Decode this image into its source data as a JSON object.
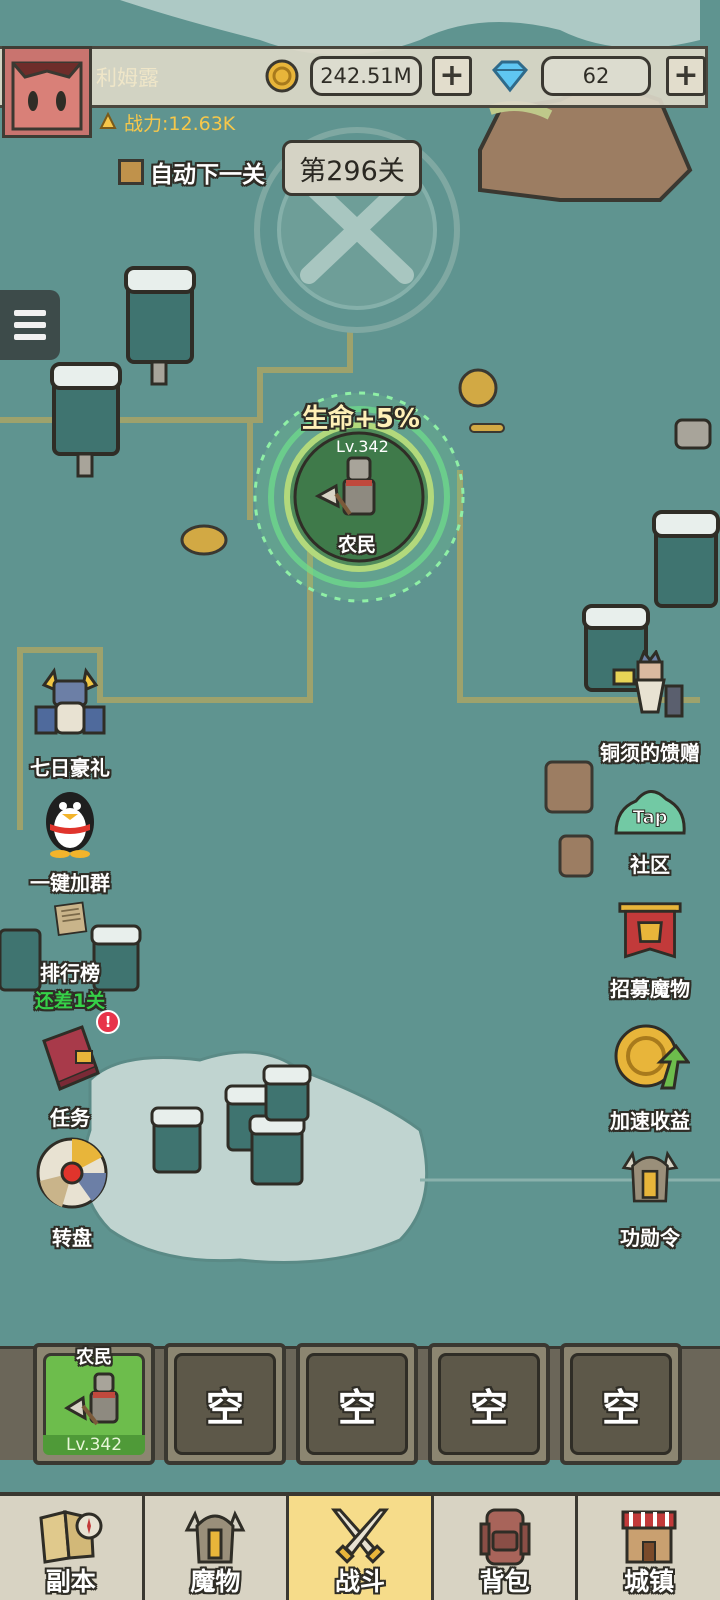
{
  "player": {
    "name": "利姆露",
    "gold": "242.51M",
    "gems": "62",
    "power": "战力:12.63K"
  },
  "stage": {
    "auto_next_label": "自动下一关",
    "level_label": "第296关"
  },
  "hero_marker": {
    "bonus": "生命+5%",
    "level": "Lv.342",
    "name": "农民"
  },
  "left_buttons": [
    {
      "label": "七日豪礼",
      "icon": "viking-gift-icon"
    },
    {
      "label": "一键加群",
      "icon": "penguin-icon"
    },
    {
      "label": "排行榜",
      "sub": "还差1关",
      "icon": "scroll-icon"
    },
    {
      "label": "任务",
      "icon": "book-icon",
      "badge": "!"
    },
    {
      "label": "转盘",
      "icon": "wheel-icon"
    }
  ],
  "right_buttons": [
    {
      "label": "铜须的馈赠",
      "icon": "dwarf-icon"
    },
    {
      "label": "社区",
      "icon": "tap-slime-icon",
      "icon_text": "Tap"
    },
    {
      "label": "招募魔物",
      "icon": "banner-icon"
    },
    {
      "label": "加速收益",
      "icon": "coin-arrow-icon"
    },
    {
      "label": "功勋令",
      "icon": "helmet-icon"
    }
  ],
  "party": {
    "hero": {
      "name": "农民",
      "level": "Lv.342"
    },
    "empty_label": "空",
    "empty_slots": 4
  },
  "nav": [
    {
      "label": "副本",
      "icon": "map-icon",
      "active": false
    },
    {
      "label": "魔物",
      "icon": "monster-icon",
      "active": false
    },
    {
      "label": "战斗",
      "icon": "swords-icon",
      "active": true
    },
    {
      "label": "背包",
      "icon": "backpack-icon",
      "active": false
    },
    {
      "label": "城镇",
      "icon": "house-icon",
      "active": false
    }
  ],
  "colors": {
    "map_bg": "#5f9490",
    "path": "#a9a466",
    "active_tab": "#f6dc8a",
    "power_text": "#f6c74a",
    "rank_sub": "#36d148"
  }
}
